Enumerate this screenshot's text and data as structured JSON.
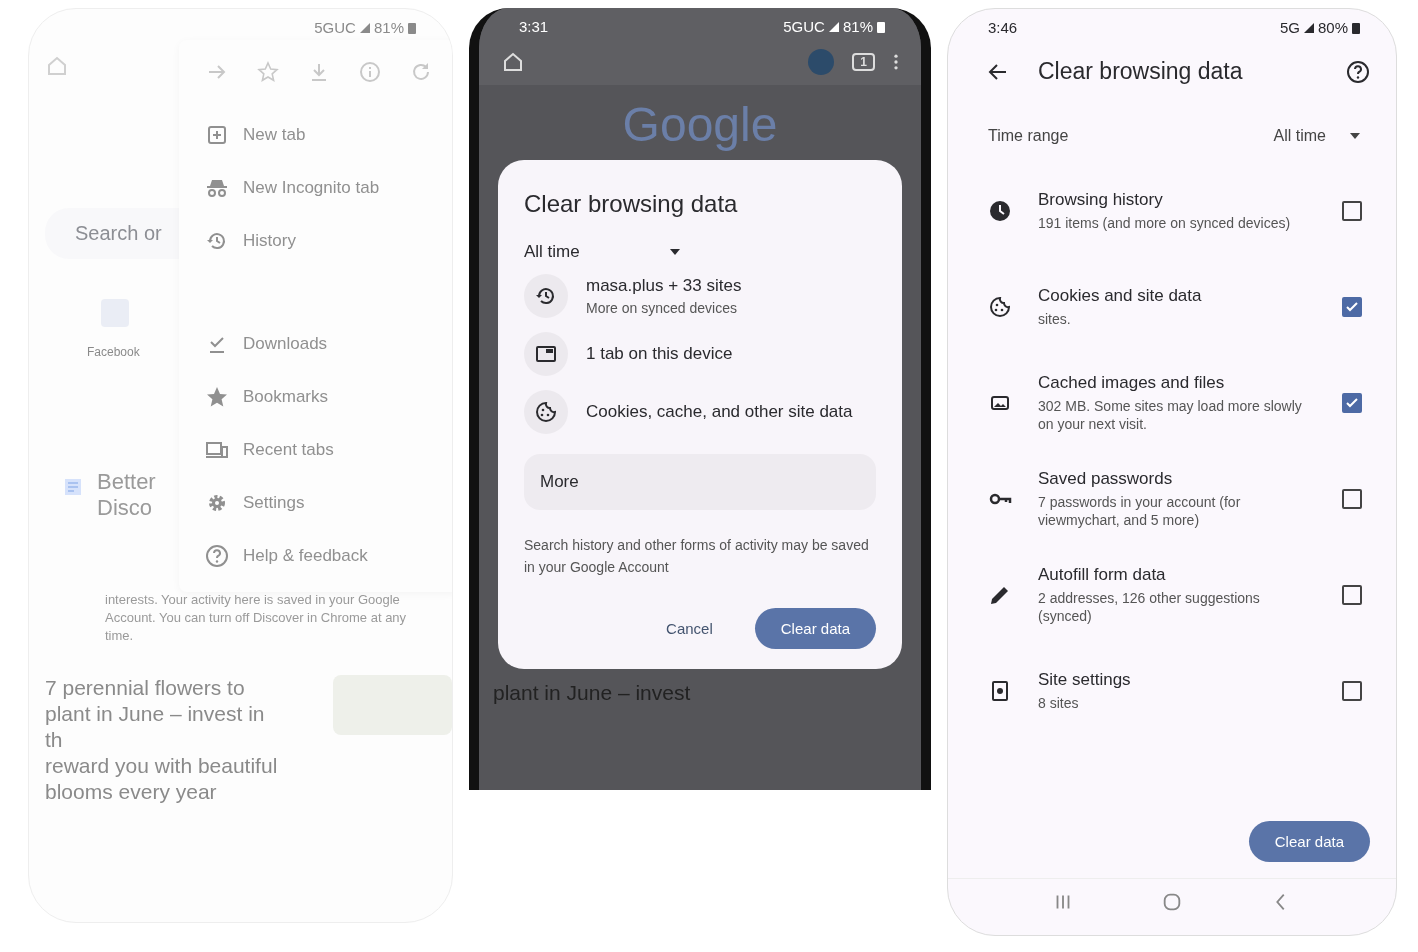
{
  "left_screen": {
    "status": {
      "network": "5GUC",
      "battery": "81%"
    },
    "search_placeholder": "Search or",
    "shortcut": "Facebook",
    "menu": [
      {
        "kind": "plus",
        "label": "New tab"
      },
      {
        "kind": "incognito",
        "label": "New Incognito tab"
      },
      {
        "kind": "history",
        "label": "History"
      },
      {
        "kind": "download",
        "label": "Downloads"
      },
      {
        "kind": "star",
        "label": "Bookmarks"
      },
      {
        "kind": "devices",
        "label": "Recent tabs"
      },
      {
        "kind": "gear",
        "label": "Settings"
      },
      {
        "kind": "help",
        "label": "Help & feedback"
      }
    ],
    "discover": {
      "title_lines": [
        "Better",
        "Disco"
      ],
      "text": "interests. Your activity here is saved in your Google Account. You can turn off Discover in Chrome at any time."
    },
    "article_lines": [
      "7 perennial flowers to",
      "plant in June – invest in",
      "th",
      "reward you with beautiful",
      "blooms every year"
    ]
  },
  "middle_screen": {
    "status": {
      "time": "3:31",
      "network": "5GUC",
      "battery": "81%"
    },
    "tab_count": "1",
    "logo": "Google",
    "dialog": {
      "title": "Clear browsing data",
      "time_range": "All time",
      "items": [
        {
          "kind": "history",
          "title": "masa.plus + 33 sites",
          "subtitle": "More on synced devices"
        },
        {
          "kind": "tab",
          "title": "1 tab on this device"
        },
        {
          "kind": "cookie",
          "title": "Cookies, cache, and other site data"
        }
      ],
      "more": "More",
      "note": "Search history and other forms of activity may be saved in your Google Account",
      "cancel": "Cancel",
      "confirm": "Clear data"
    },
    "background_text": "plant in June – invest"
  },
  "right_screen": {
    "status": {
      "time": "3:46",
      "network": "5G",
      "battery": "80%"
    },
    "title": "Clear browsing data",
    "time_range_label": "Time range",
    "time_range": "All time",
    "items": [
      {
        "kind": "clock",
        "title": "Browsing history",
        "subtitle": "191 items (and more on synced devices)",
        "checked": false
      },
      {
        "kind": "cookie",
        "title": "Cookies and site data",
        "subtitle": "sites.",
        "checked": true
      },
      {
        "kind": "image",
        "title": "Cached images and files",
        "subtitle": "302 MB. Some sites may load more slowly on your next visit.",
        "checked": true
      },
      {
        "kind": "key",
        "title": "Saved passwords",
        "subtitle": "7 passwords in your account (for viewmychart, and 5 more)",
        "checked": false
      },
      {
        "kind": "pencil",
        "title": "Autofill form data",
        "subtitle": "2 addresses, 126 other suggestions (synced)",
        "checked": false
      },
      {
        "kind": "site",
        "title": "Site settings",
        "subtitle": "8 sites",
        "checked": false
      }
    ],
    "confirm": "Clear data"
  }
}
